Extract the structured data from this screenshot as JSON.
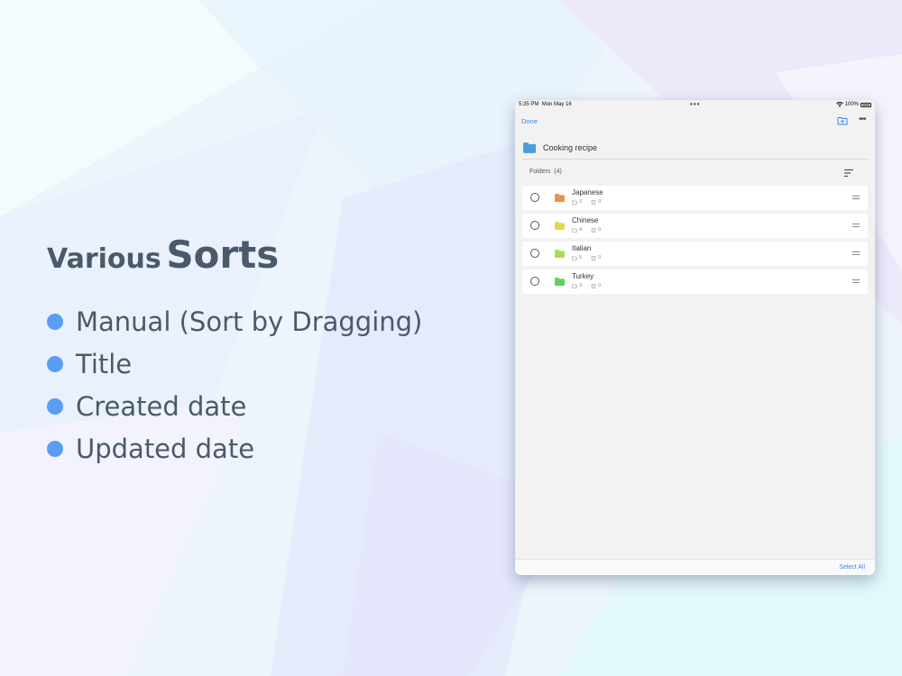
{
  "promo": {
    "title_small": "Various",
    "title_big": "Sorts",
    "features": [
      {
        "label": "Manual (Sort by Dragging)"
      },
      {
        "label": "Title"
      },
      {
        "label": "Created date"
      },
      {
        "label": "Updated date"
      }
    ],
    "bullet_color": "#5b9cf4"
  },
  "device": {
    "status": {
      "time": "5:35 PM",
      "date": "Mon May 16",
      "battery": "100%"
    },
    "nav": {
      "done_label": "Done",
      "new_folder_icon": "folder-plus-icon",
      "more_icon": "ellipsis-icon"
    },
    "header": {
      "title": "Cooking recipe",
      "icon": "folder-icon",
      "color": "#4a9fe0"
    },
    "section": {
      "label": "Folders",
      "count": "(4)",
      "sort_icon": "sort-icon"
    },
    "folders": [
      {
        "name": "Japanese",
        "folders": "3",
        "notes": "0",
        "color": "#e8914a"
      },
      {
        "name": "Chinese",
        "folders": "4",
        "notes": "0",
        "color": "#e3d64a"
      },
      {
        "name": "Italian",
        "folders": "5",
        "notes": "0",
        "color": "#a9dc4f"
      },
      {
        "name": "Turkey",
        "folders": "3",
        "notes": "0",
        "color": "#5fd05a"
      }
    ],
    "bottom": {
      "select_all_label": "Select All"
    },
    "accent": "#3b82f6"
  }
}
